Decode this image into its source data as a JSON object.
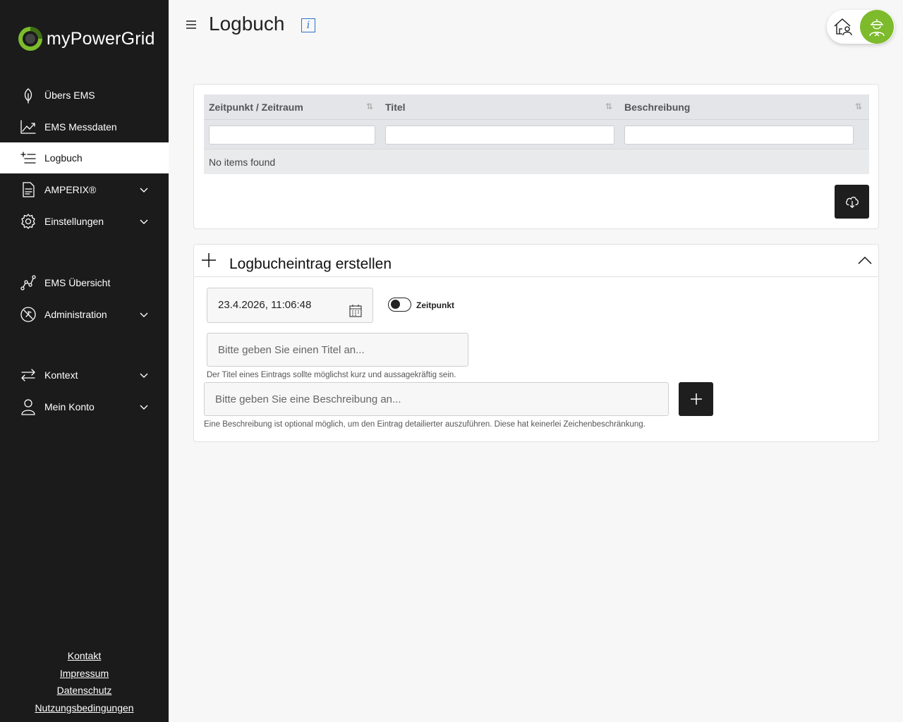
{
  "app": {
    "brand": "myPowerGrid",
    "brand_color": "#7dbb2c"
  },
  "sidebar": {
    "items": [
      {
        "label": "Übers EMS",
        "icon": "leaf-icon"
      },
      {
        "label": "EMS Messdaten",
        "icon": "chart-line-icon"
      },
      {
        "label": "Logbuch",
        "icon": "list-add-icon",
        "active": true
      },
      {
        "label": "AMPERIX®",
        "icon": "document-icon",
        "expandable": true
      },
      {
        "label": "Einstellungen",
        "icon": "gear-icon",
        "expandable": true
      },
      {
        "label": "EMS Übersicht",
        "icon": "network-icon"
      },
      {
        "label": "Administration",
        "icon": "admin-icon",
        "expandable": true
      },
      {
        "label": "Kontext",
        "icon": "arrows-swap-icon",
        "expandable": true
      },
      {
        "label": "Mein Konto",
        "icon": "user-icon",
        "expandable": true
      }
    ],
    "footer": [
      "Kontakt",
      "Impressum",
      "Datenschutz",
      "Nutzungsbedingungen"
    ]
  },
  "header": {
    "title": "Logbuch",
    "info_glyph": "i"
  },
  "table": {
    "columns": [
      "Zeitpunkt / Zeitraum",
      "Titel",
      "Beschreibung"
    ],
    "sort_glyph": "⇅",
    "empty_text": "No items found"
  },
  "form": {
    "title": "Logbucheintrag erstellen",
    "date_value": "23.4.2026, 11:06:48",
    "toggle_label": "Zeitpunkt",
    "title_placeholder": "Bitte geben Sie einen Titel an...",
    "title_hint": "Der Titel eines Eintrags sollte möglichst kurz und aussagekräftig sein.",
    "desc_placeholder": "Bitte geben Sie eine Beschreibung an...",
    "desc_hint": "Eine Beschreibung ist optional möglich, um den Eintrag detailierter auszuführen. Diese hat keinerlei Zeichenbeschränkung."
  }
}
